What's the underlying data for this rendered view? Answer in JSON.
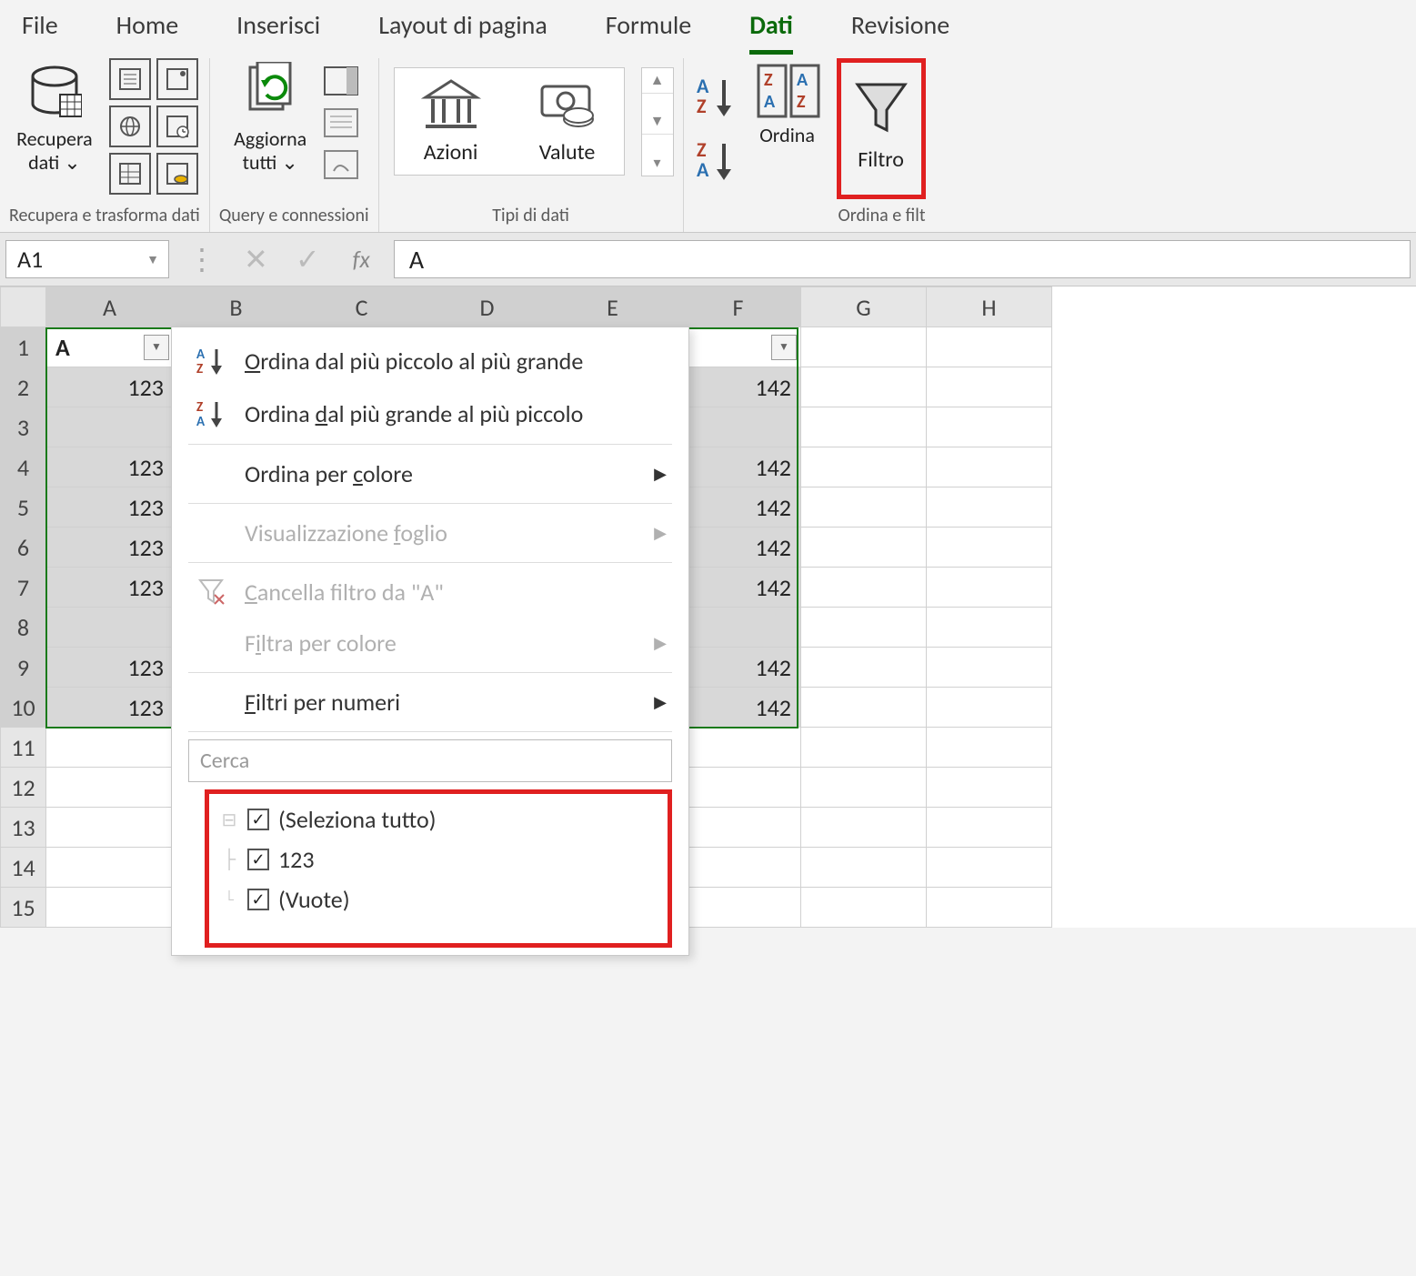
{
  "ribbon": {
    "tabs": [
      "File",
      "Home",
      "Inserisci",
      "Layout di pagina",
      "Formule",
      "Dati",
      "Revisione"
    ],
    "active_tab": "Dati",
    "groups": {
      "get_transform": {
        "big_button_label": "Recupera\ndati ⌄",
        "label": "Recupera e trasforma dati"
      },
      "queries": {
        "big_button_label": "Aggiorna\ntutti ⌄",
        "label": "Query e connessioni"
      },
      "data_types": {
        "items": [
          "Azioni",
          "Valute"
        ],
        "label": "Tipi di dati"
      },
      "sort_filter": {
        "ordina_label": "Ordina",
        "filtro_label": "Filtro",
        "label": "Ordina e filt"
      }
    }
  },
  "formula_bar": {
    "name_box": "A1",
    "fx": "fx",
    "formula": "A"
  },
  "sheet": {
    "columns": [
      "A",
      "B",
      "C",
      "D",
      "E",
      "F",
      "G",
      "H"
    ],
    "rows": [
      1,
      2,
      3,
      4,
      5,
      6,
      7,
      8,
      9,
      10,
      11,
      12,
      13,
      14,
      15
    ],
    "header_cell": "A",
    "col_A_values": {
      "2": "123",
      "3": "",
      "4": "123",
      "5": "123",
      "6": "123",
      "7": "123",
      "8": "",
      "9": "123",
      "10": "123"
    },
    "col_F_values": {
      "2": "142",
      "3": "",
      "4": "142",
      "5": "142",
      "6": "142",
      "7": "142",
      "8": "",
      "9": "142",
      "10": "142"
    }
  },
  "filter_menu": {
    "sort_asc": "Ordina dal più piccolo al più grande",
    "sort_desc": "Ordina dal più grande al più piccolo",
    "sort_color": "Ordina per colore",
    "sheet_view": "Visualizzazione foglio",
    "clear_filter": "Cancella filtro da \"A\"",
    "filter_color": "Filtra per colore",
    "number_filters": "Filtri per numeri",
    "search_placeholder": "Cerca",
    "checks": [
      "(Seleziona tutto)",
      "123",
      "(Vuote)"
    ]
  }
}
